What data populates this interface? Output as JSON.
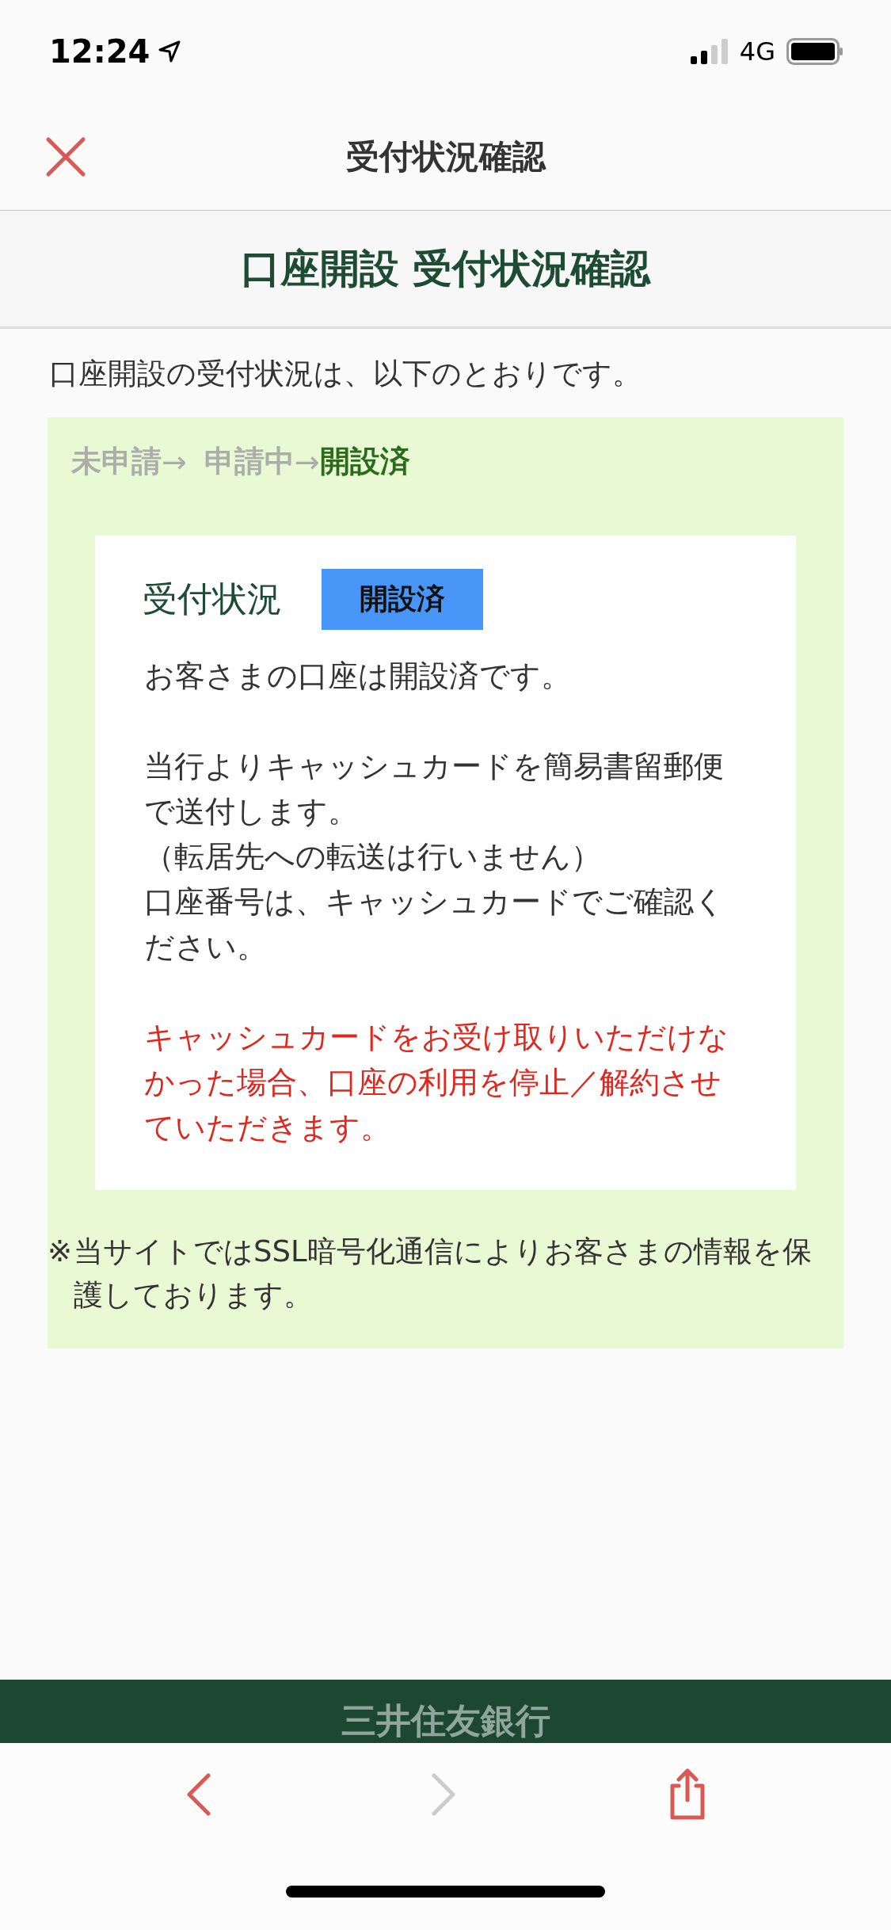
{
  "status_bar": {
    "time": "12:24",
    "network": "4G"
  },
  "nav": {
    "title": "受付状況確認"
  },
  "section": {
    "title": "口座開設 受付状況確認"
  },
  "intro": "口座開設の受付状況は、以下のとおりです。",
  "steps": [
    {
      "label": "未申請",
      "arrow": "→",
      "selected": false
    },
    {
      "label": "申請中",
      "arrow": "→",
      "selected": false
    },
    {
      "label": "開設済",
      "selected": true
    }
  ],
  "status_card": {
    "label": "受付状況",
    "badge": "開設済",
    "paragraphs": [
      {
        "kind": "normal",
        "lines": [
          "お客さまの口座は開設済です。"
        ]
      },
      {
        "kind": "normal",
        "lines": [
          "当行よりキャッシュカードを簡易書留郵便で送付します。",
          "（転居先への転送は行いません）",
          "口座番号は、キャッシュカードでご確認ください。"
        ]
      },
      {
        "kind": "warning",
        "lines": [
          "キャッシュカードをお受け取りいただけなかった場合、口座の利用を停止／解約させていただきます。"
        ]
      }
    ]
  },
  "note": {
    "mark": "※",
    "text": "当サイトではSSL暗号化通信によりお客さまの情報を保護しております。"
  },
  "footer": {
    "bank_name": "三井住友銀行"
  },
  "toolbar": {
    "back": {
      "disabled": false
    },
    "forward": {
      "disabled": true
    }
  }
}
